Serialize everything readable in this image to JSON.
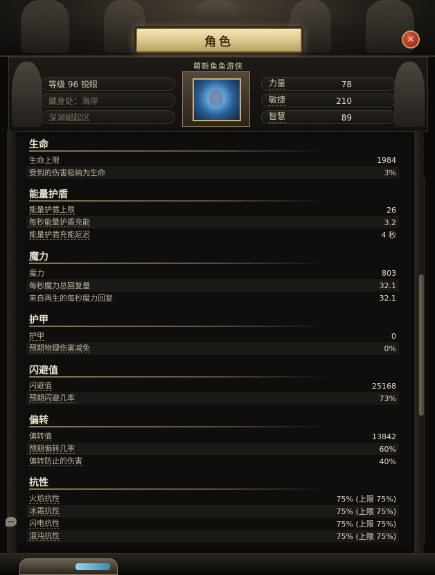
{
  "window": {
    "title": "角色",
    "close_icon": "close-icon"
  },
  "header": {
    "character_name": "萌新鱼鱼游侠",
    "left_info": [
      "等级 96 锐眼",
      "藏身处：海岸",
      "深渊崛起区"
    ],
    "attributes": [
      {
        "label": "力量",
        "value": "78"
      },
      {
        "label": "敏捷",
        "value": "210"
      },
      {
        "label": "智慧",
        "value": "89"
      }
    ]
  },
  "sections": [
    {
      "title": "生命",
      "rows": [
        {
          "label": "生命上限",
          "value": "1984"
        },
        {
          "label": "受到的伤害吸纳为生命",
          "value": "3%"
        }
      ]
    },
    {
      "title": "能量护盾",
      "rows": [
        {
          "label": "能量护盾上限",
          "value": "26"
        },
        {
          "label": "每秒能量护盾充能",
          "value": "3.2"
        },
        {
          "label": "能量护盾充能延迟",
          "value": "4 秒"
        }
      ]
    },
    {
      "title": "魔力",
      "rows": [
        {
          "label": "魔力",
          "value": "803"
        },
        {
          "label": "每秒魔力总回复量",
          "value": "32.1"
        },
        {
          "label": "来自再生的每秒魔力回复",
          "value": "32.1"
        }
      ]
    },
    {
      "title": "护甲",
      "rows": [
        {
          "label": "护甲",
          "value": "0"
        },
        {
          "label": "预期物理伤害减免",
          "value": "0%"
        }
      ]
    },
    {
      "title": "闪避值",
      "rows": [
        {
          "label": "闪避值",
          "value": "25168"
        },
        {
          "label": "预期闪避几率",
          "value": "73%"
        }
      ]
    },
    {
      "title": "偏转",
      "rows": [
        {
          "label": "偏转值",
          "value": "13842"
        },
        {
          "label": "预期偏转几率",
          "value": "60%"
        },
        {
          "label": "偏转防止的伤害",
          "value": "40%"
        }
      ]
    },
    {
      "title": "抗性",
      "rows": [
        {
          "label": "火焰抗性",
          "value": "75% (上限 75%)"
        },
        {
          "label": "冰霜抗性",
          "value": "75% (上限 75%)"
        },
        {
          "label": "闪电抗性",
          "value": "75% (上限 75%)"
        },
        {
          "label": "混沌抗性",
          "value": "75% (上限 75%)"
        }
      ]
    }
  ],
  "chat": {
    "icon": "chat-bubble-icon",
    "glyph": "…"
  }
}
